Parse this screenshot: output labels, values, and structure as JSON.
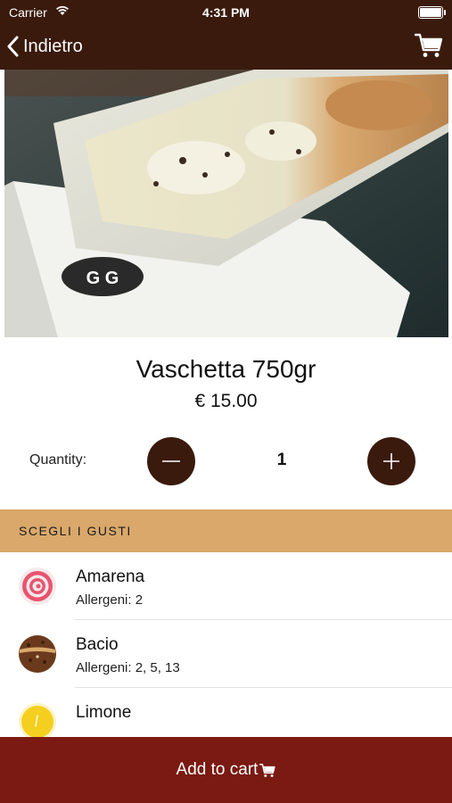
{
  "status_bar": {
    "carrier": "Carrier",
    "time": "4:31 PM"
  },
  "nav": {
    "back_label": "Indietro",
    "cart_icon": "cart-icon"
  },
  "product": {
    "name": "Vaschetta 750gr",
    "price": "€ 15.00",
    "image_icon": "ice-cream-tub-photo"
  },
  "quantity": {
    "label": "Quantity:",
    "value": "1"
  },
  "section": {
    "title": "SCEGLI I GUSTI"
  },
  "flavors": [
    {
      "name": "Amarena",
      "allergens": "Allergeni: 2",
      "icon": "amarena-icon"
    },
    {
      "name": "Bacio",
      "allergens": "Allergeni: 2, 5, 13",
      "icon": "bacio-icon"
    },
    {
      "name": "Limone",
      "allergens": "",
      "icon": "limone-icon"
    }
  ],
  "footer": {
    "add_to_cart_label": "Add to cart"
  },
  "colors": {
    "nav_bg": "#3a1a0d",
    "section_bg": "#d9a86a",
    "cta_bg": "#7a1a12"
  }
}
